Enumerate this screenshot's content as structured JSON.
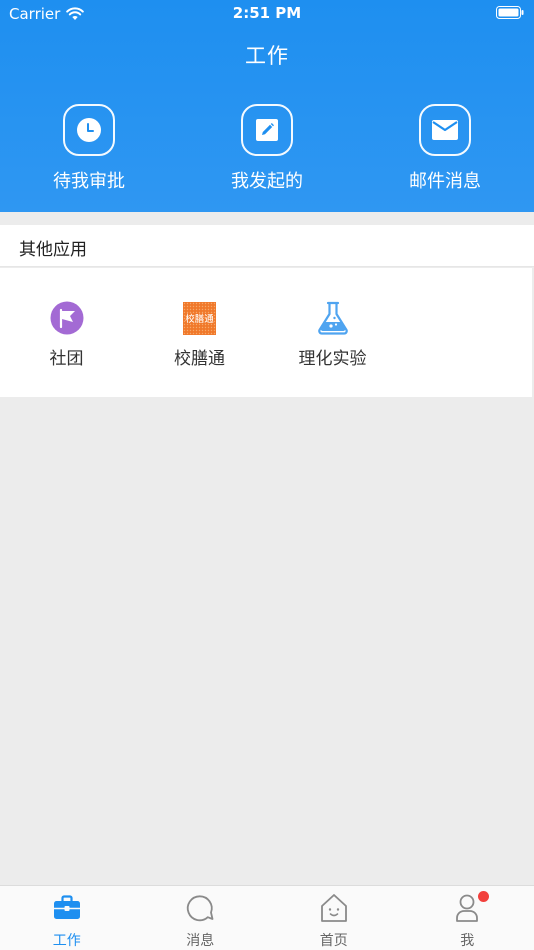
{
  "status_bar": {
    "carrier": "Carrier",
    "time": "2:51 PM"
  },
  "header": {
    "title": "工作"
  },
  "quick_actions": [
    {
      "label": "待我审批",
      "icon": "clock-icon"
    },
    {
      "label": "我发起的",
      "icon": "edit-icon"
    },
    {
      "label": "邮件消息",
      "icon": "mail-icon"
    }
  ],
  "other_apps": {
    "title": "其他应用",
    "items": [
      {
        "label": "社团",
        "icon": "flag-icon",
        "icon_color": "#a36ad4"
      },
      {
        "label": "校膳通",
        "icon": "xiaoshantong-logo",
        "icon_text": "校膳通",
        "icon_color": "#f0782a"
      },
      {
        "label": "理化实验",
        "icon": "flask-icon",
        "icon_color": "#4fa4f0"
      }
    ]
  },
  "tabbar": {
    "items": [
      {
        "label": "工作",
        "icon": "briefcase-icon",
        "active": true
      },
      {
        "label": "消息",
        "icon": "chat-bubble-icon",
        "active": false
      },
      {
        "label": "首页",
        "icon": "home-icon",
        "active": false
      },
      {
        "label": "我",
        "icon": "user-icon",
        "active": false,
        "badge": true
      }
    ],
    "active_color": "#1e8ff0",
    "badge_color": "#f2403c"
  },
  "colors": {
    "primary": "#1e8ff0",
    "background": "#ececec"
  }
}
